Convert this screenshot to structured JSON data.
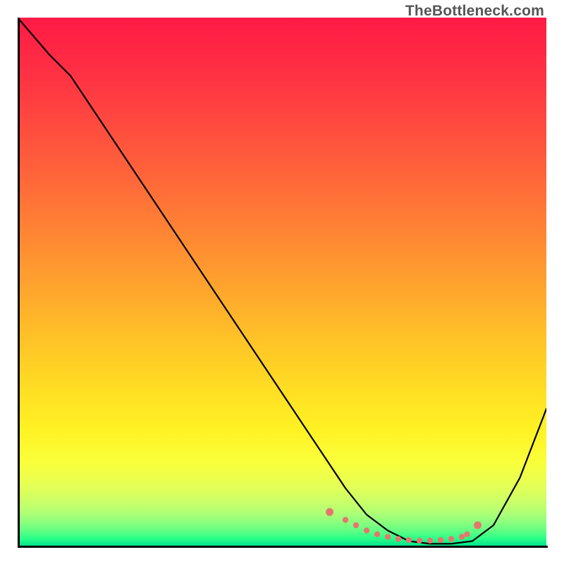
{
  "watermark": "TheBottleneck.com",
  "gradient_stops": [
    {
      "offset": 0.0,
      "color": "#ff1a45"
    },
    {
      "offset": 0.1,
      "color": "#ff2f44"
    },
    {
      "offset": 0.2,
      "color": "#ff4a3f"
    },
    {
      "offset": 0.3,
      "color": "#ff653a"
    },
    {
      "offset": 0.4,
      "color": "#ff8334"
    },
    {
      "offset": 0.5,
      "color": "#ffa12e"
    },
    {
      "offset": 0.6,
      "color": "#ffc028"
    },
    {
      "offset": 0.7,
      "color": "#ffdd23"
    },
    {
      "offset": 0.78,
      "color": "#fff224"
    },
    {
      "offset": 0.84,
      "color": "#faff3a"
    },
    {
      "offset": 0.88,
      "color": "#e8ff52"
    },
    {
      "offset": 0.91,
      "color": "#d0ff65"
    },
    {
      "offset": 0.935,
      "color": "#b2ff74"
    },
    {
      "offset": 0.955,
      "color": "#8aff7e"
    },
    {
      "offset": 0.972,
      "color": "#5cff84"
    },
    {
      "offset": 0.985,
      "color": "#2aff88"
    },
    {
      "offset": 1.0,
      "color": "#00e08a"
    }
  ],
  "chart_data": {
    "type": "line",
    "title": "",
    "xlabel": "",
    "ylabel": "",
    "xlim": [
      0,
      100
    ],
    "ylim": [
      0,
      100
    ],
    "series": [
      {
        "name": "curve",
        "x": [
          0,
          6,
          10,
          20,
          30,
          40,
          50,
          58,
          62,
          66,
          70,
          74,
          78,
          82,
          86,
          90,
          95,
          100
        ],
        "y": [
          100,
          93,
          89,
          74,
          59,
          44,
          29,
          17,
          11,
          6,
          3,
          1,
          0.5,
          0.5,
          1,
          4,
          13,
          26
        ]
      },
      {
        "name": "flat-dots",
        "x": [
          59,
          62,
          64,
          66,
          68,
          70,
          72,
          74,
          76,
          78,
          80,
          82,
          84,
          85,
          87
        ],
        "y": [
          6.5,
          5,
          4,
          3,
          2.3,
          1.8,
          1.4,
          1.2,
          1.1,
          1.1,
          1.2,
          1.4,
          1.8,
          2.3,
          4
        ]
      }
    ],
    "dot_color": "#e4776d",
    "line_color": "#000000"
  }
}
